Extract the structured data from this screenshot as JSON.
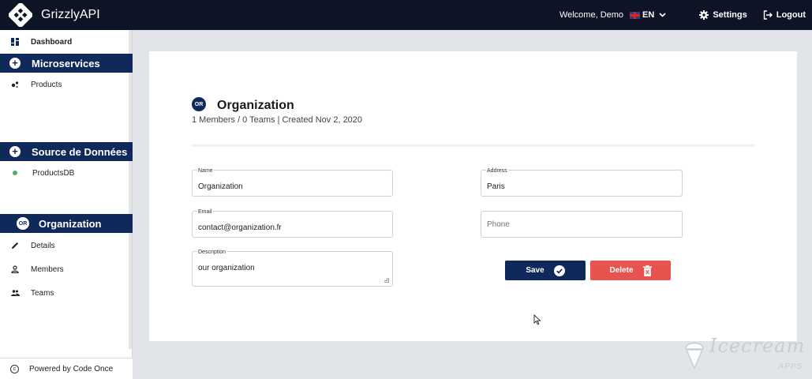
{
  "topbar": {
    "app_title": "GrizzlyAPI",
    "welcome": "Welcome,  Demo",
    "language": "EN",
    "settings_label": "Settings",
    "logout_label": "Logout"
  },
  "sidebar": {
    "dashboard_label": "Dashboard",
    "microservices": {
      "title": "Microservices",
      "items": [
        {
          "label": "Products"
        }
      ]
    },
    "datasources": {
      "title": "Source de Données",
      "items": [
        {
          "label": "ProductsDB",
          "status_color": "#59a95d"
        }
      ]
    },
    "organization": {
      "badge": "OR",
      "title": "Organization",
      "items": [
        {
          "label": "Details"
        },
        {
          "label": "Members"
        },
        {
          "label": "Teams"
        }
      ]
    },
    "footer": "Powered by Code Once"
  },
  "main": {
    "badge": "OR",
    "title": "Organization",
    "subtitle": "1 Members / 0 Teams | Created Nov 2, 2020",
    "form": {
      "name": {
        "label": "Name",
        "value": "Organization"
      },
      "email": {
        "label": "Email",
        "value": "contact@organization.fr"
      },
      "description": {
        "label": "Description",
        "value": "our organization"
      },
      "address": {
        "label": "Address",
        "value": "Paris"
      },
      "phone": {
        "placeholder": "Phone"
      }
    },
    "save_label": "Save",
    "delete_label": "Delete"
  },
  "watermark": {
    "text": "Icecream",
    "sub": "APPS"
  },
  "colors": {
    "navy": "#0f2a5a",
    "topbar": "#0c1426",
    "danger": "#e8524f",
    "background": "#e1e4e8"
  }
}
